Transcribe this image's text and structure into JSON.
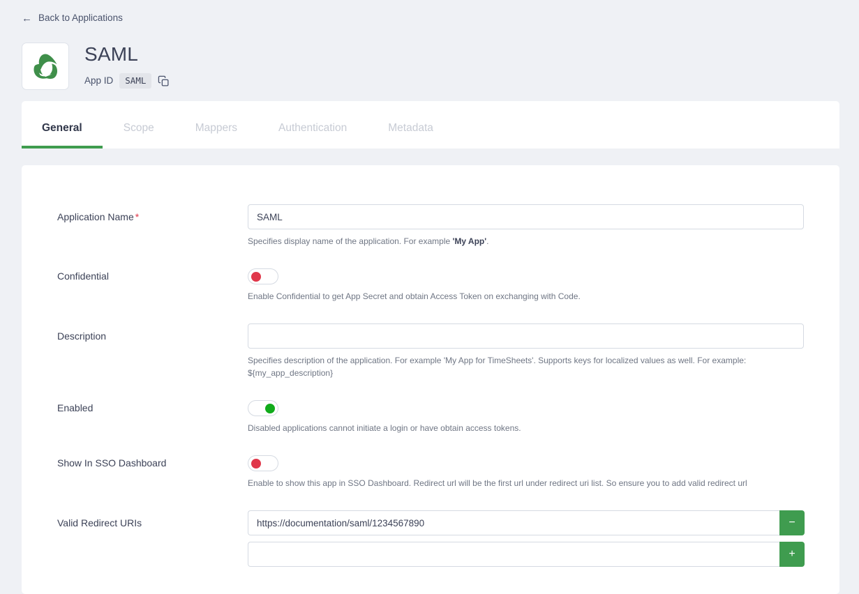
{
  "back_link": {
    "label": "Back to Applications",
    "icon": "arrow-left-icon"
  },
  "app_header": {
    "logo_icon": "app-logo-triangle-swirl",
    "title": "SAML",
    "app_id_label": "App ID",
    "app_id_value": "SAML",
    "copy_icon": "copy-icon"
  },
  "tabs": [
    {
      "label": "General",
      "active": true
    },
    {
      "label": "Scope",
      "active": false
    },
    {
      "label": "Mappers",
      "active": false
    },
    {
      "label": "Authentication",
      "active": false
    },
    {
      "label": "Metadata",
      "active": false
    }
  ],
  "form": {
    "application_name": {
      "label": "Application Name",
      "required_marker": "*",
      "value": "SAML",
      "placeholder": "",
      "help_prefix": "Specifies display name of the application. For example ",
      "help_bold": "'My App'",
      "help_suffix": "."
    },
    "confidential": {
      "label": "Confidential",
      "state": "off",
      "help": "Enable Confidential to get App Secret and obtain Access Token on exchanging with Code."
    },
    "description": {
      "label": "Description",
      "value": "",
      "placeholder": "",
      "help": "Specifies description of the application. For example 'My App for TimeSheets'. Supports keys for localized values as well. For example: ${my_app_description}"
    },
    "enabled": {
      "label": "Enabled",
      "state": "on",
      "help": "Disabled applications cannot initiate a login or have obtain access tokens."
    },
    "show_in_sso_dashboard": {
      "label": "Show In SSO Dashboard",
      "state": "off",
      "help": "Enable to show this app in SSO Dashboard. Redirect url will be the first url under redirect uri list. So ensure you to add valid redirect url"
    },
    "valid_redirect_uris": {
      "label": "Valid Redirect URIs",
      "rows": [
        {
          "value": "https://documentation/saml/1234567890",
          "button": "−",
          "button_name": "remove"
        },
        {
          "value": "",
          "button": "+",
          "button_name": "add"
        }
      ],
      "help": ""
    }
  },
  "colors": {
    "page_bg": "#eff1f5",
    "card_bg": "#ffffff",
    "accent_green": "#3f9c4f",
    "toggle_on": "#11ab1b",
    "toggle_off": "#e0374a",
    "text_primary": "#3c4257",
    "text_muted": "#6f7684",
    "tab_inactive": "#c7cbd4",
    "border": "#d5dae2"
  }
}
